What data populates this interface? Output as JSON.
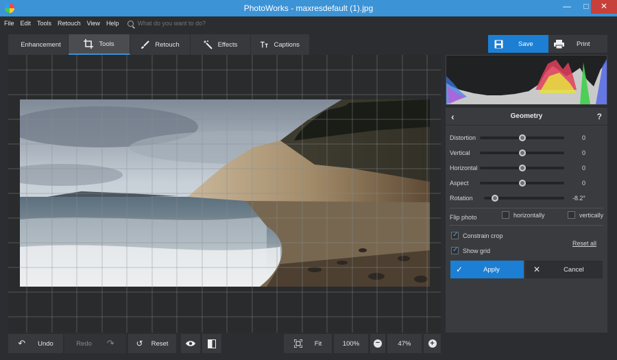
{
  "window": {
    "title": "PhotoWorks - maxresdefault (1).jpg"
  },
  "menu": [
    "File",
    "Edit",
    "Tools",
    "Retouch",
    "View",
    "Help"
  ],
  "search": {
    "placeholder": "What do you want to do?"
  },
  "tabs": [
    {
      "label": "Enhancement"
    },
    {
      "label": "Tools"
    },
    {
      "label": "Retouch"
    },
    {
      "label": "Effects"
    },
    {
      "label": "Captions"
    }
  ],
  "actions": {
    "save": "Save",
    "print": "Print"
  },
  "bottom": {
    "undo": "Undo",
    "redo": "Redo",
    "reset": "Reset",
    "fit": "Fit",
    "zoom_100": "100%",
    "zoom_value": "47%"
  },
  "panel": {
    "title": "Geometry",
    "sliders": [
      {
        "label": "Distortion",
        "value": "0",
        "fraction": 0.5
      },
      {
        "label": "Vertical",
        "value": "0",
        "fraction": 0.5
      },
      {
        "label": "Horizontal",
        "value": "0",
        "fraction": 0.5
      },
      {
        "label": "Aspect",
        "value": "0",
        "fraction": 0.5
      },
      {
        "label": "Rotation",
        "value": "-8.2°",
        "fraction": 0.14
      }
    ],
    "flip": {
      "label": "Flip photo",
      "horizontally": "horizontally",
      "vertically": "vertically"
    },
    "constrain_crop": "Constrain crop",
    "show_grid": "Show grid",
    "reset_all": "Reset all",
    "apply": "Apply",
    "cancel": "Cancel"
  }
}
